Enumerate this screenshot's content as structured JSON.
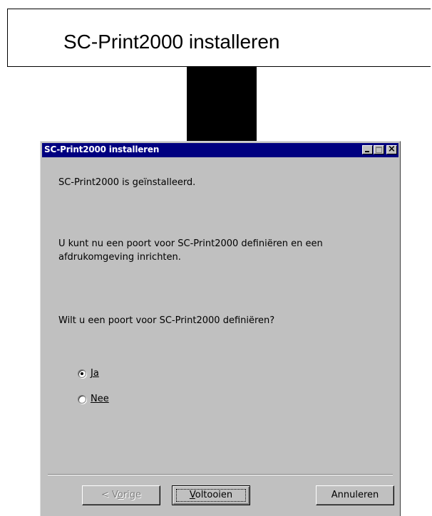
{
  "banner": {
    "title": "SC-Print2000 installeren"
  },
  "dialog": {
    "title": "SC-Print2000 installeren",
    "installed_message": "SC-Print2000 is geïnstalleerd.",
    "info_line1": "U kunt nu een poort voor SC-Print2000 definiëren en een",
    "info_line2": "afdrukomgeving inrichten.",
    "question": "Wilt u een poort voor SC-Print2000 definiëren?",
    "options": [
      {
        "label": "Ja",
        "checked": true
      },
      {
        "label": "Nee",
        "checked": false
      }
    ],
    "buttons": {
      "back_prefix": "< V",
      "back_underline": "o",
      "back_suffix": "rige",
      "finish_underline": "V",
      "finish_rest": "oltooien",
      "cancel": "Annuleren"
    }
  },
  "colors": {
    "titlebar": "#000080",
    "dialog_bg": "#c0c0c0",
    "connector": "#000000"
  }
}
